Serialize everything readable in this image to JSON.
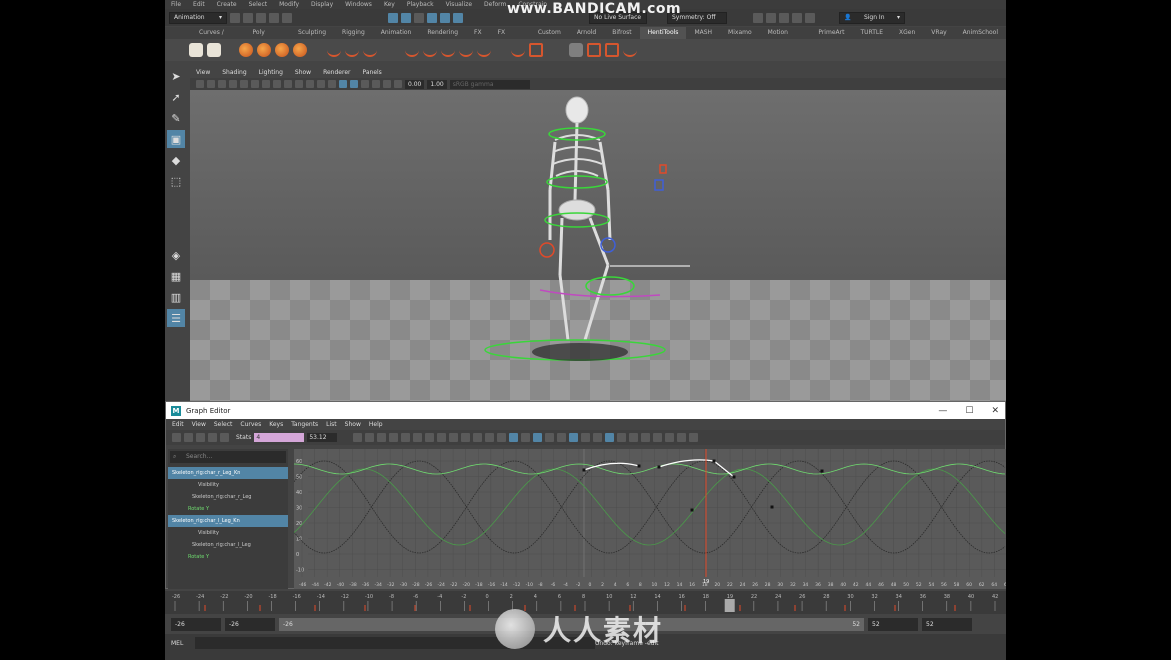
{
  "menubar": {
    "items": [
      "File",
      "Edit",
      "Create",
      "Select",
      "Modify",
      "Display",
      "Windows",
      "Key",
      "Playback",
      "Visualize",
      "Deform",
      "Constrain"
    ]
  },
  "statusline": {
    "mode": "Animation",
    "live_surface": "No Live Surface",
    "symmetry": "Symmetry: Off",
    "sign_in": "Sign In"
  },
  "watermark": "www.BANDICAM.com",
  "shelf_tabs": [
    {
      "label": "Curves / Surfaces",
      "active": false
    },
    {
      "label": "Poly Modeling",
      "active": false
    },
    {
      "label": "Sculpting",
      "active": false
    },
    {
      "label": "Rigging",
      "active": false
    },
    {
      "label": "Animation",
      "active": false
    },
    {
      "label": "Rendering",
      "active": false
    },
    {
      "label": "FX",
      "active": false
    },
    {
      "label": "FX Caching",
      "active": false
    },
    {
      "label": "Custom",
      "active": false
    },
    {
      "label": "Arnold",
      "active": false
    },
    {
      "label": "Bifrost",
      "active": false
    },
    {
      "label": "HentiTools",
      "active": true
    },
    {
      "label": "MASH",
      "active": false
    },
    {
      "label": "Mixamo",
      "active": false
    },
    {
      "label": "Motion Graphics",
      "active": false
    },
    {
      "label": "PrimeArt",
      "active": false
    },
    {
      "label": "TURTLE",
      "active": false
    },
    {
      "label": "XGen",
      "active": false
    },
    {
      "label": "VRay",
      "active": false
    },
    {
      "label": "AnimSchool",
      "active": false
    }
  ],
  "viewport": {
    "menu": [
      "View",
      "Shading",
      "Lighting",
      "Show",
      "Renderer",
      "Panels"
    ],
    "value_a": "0.00",
    "value_b": "1.00",
    "colorspace": "sRGB gamma"
  },
  "graph_editor": {
    "title": "Graph Editor",
    "menu": [
      "Edit",
      "View",
      "Select",
      "Curves",
      "Keys",
      "Tangents",
      "List",
      "Show",
      "Help"
    ],
    "stats_label": "Stats",
    "stats_frame": "4",
    "stats_value": "53.12",
    "search_placeholder": "Search...",
    "outliner": [
      {
        "label": "Skeleton_rig:char_r_Leg_Kn",
        "style": "sel"
      },
      {
        "label": "Visibility",
        "style": "normal"
      },
      {
        "label": "Skeleton_rig:char_r_Leg",
        "style": "normal"
      },
      {
        "label": "Rotate Y",
        "style": "green"
      },
      {
        "label": "Skeleton_rig:char_l_Leg_Kn",
        "style": "sel"
      },
      {
        "label": "Visibility",
        "style": "normal"
      },
      {
        "label": "Skeleton_rig:char_l_Leg",
        "style": "normal"
      },
      {
        "label": "Rotate Y",
        "style": "green"
      }
    ],
    "y_ticks": [
      "60",
      "50",
      "40",
      "30",
      "20",
      "10",
      "0",
      "-10"
    ],
    "x_ticks": [
      "-46",
      "-44",
      "-42",
      "-40",
      "-38",
      "-36",
      "-34",
      "-32",
      "-30",
      "-28",
      "-26",
      "-24",
      "-22",
      "-20",
      "-18",
      "-16",
      "-14",
      "-12",
      "-10",
      "-8",
      "-6",
      "-4",
      "-2",
      "0",
      "2",
      "4",
      "6",
      "8",
      "10",
      "12",
      "14",
      "16",
      "18",
      "20",
      "22",
      "24",
      "26",
      "28",
      "30",
      "32",
      "34",
      "36",
      "38",
      "40",
      "42",
      "44",
      "46",
      "48",
      "50",
      "52",
      "54",
      "56",
      "58",
      "60",
      "62",
      "64",
      "66"
    ],
    "current_frame": "19"
  },
  "timeline": {
    "ticks": [
      "-26",
      "-24",
      "-22",
      "-20",
      "-18",
      "-16",
      "-14",
      "-12",
      "-10",
      "-8",
      "-6",
      "-4",
      "-2",
      "0",
      "2",
      "4",
      "6",
      "8",
      "10",
      "12",
      "14",
      "16",
      "18",
      "19",
      "22",
      "24",
      "26",
      "28",
      "30",
      "32",
      "34",
      "36",
      "38",
      "40",
      "42"
    ],
    "current": "19"
  },
  "range": {
    "start_outer": "-26",
    "start_inner": "-26",
    "slider_start": "-26",
    "slider_end": "52",
    "end_inner": "52",
    "end_outer": "52"
  },
  "cmdline": {
    "label": "MEL",
    "message": "Undo: keyframe -edit"
  },
  "brand": "人人素材",
  "colors": {
    "accent": "#5285a6",
    "curve_green": "#6fdc6f",
    "stats_pink": "#d4a6d8",
    "time_red": "#e04a2a"
  }
}
